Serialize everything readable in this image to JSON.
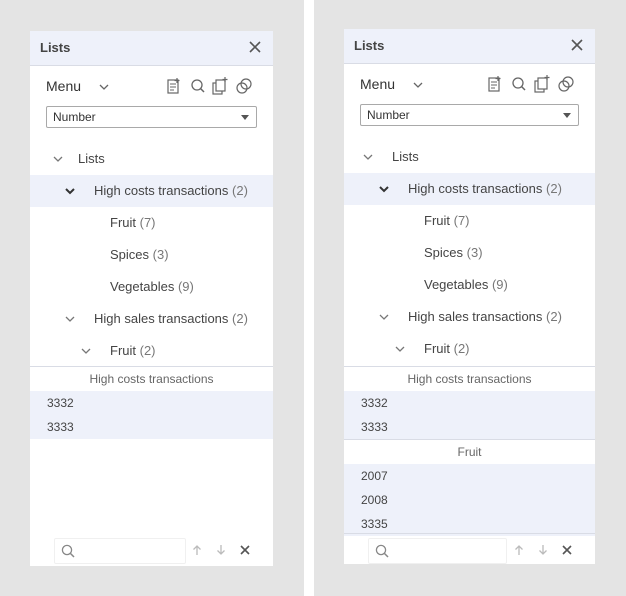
{
  "panels": [
    {
      "title": "Lists",
      "menu_label": "Menu",
      "select_value": "Number",
      "tree": [
        {
          "label": "Lists",
          "count": "",
          "level": 0,
          "chevron": "down",
          "selected": false
        },
        {
          "label": "High costs transactions",
          "count": "(2)",
          "level": 1,
          "chevron": "down-bold",
          "selected": true
        },
        {
          "label": "Fruit",
          "count": "(7)",
          "level": 2,
          "chevron": "",
          "selected": false
        },
        {
          "label": "Spices",
          "count": "(3)",
          "level": 2,
          "chevron": "",
          "selected": false
        },
        {
          "label": "Vegetables",
          "count": "(9)",
          "level": 2,
          "chevron": "",
          "selected": false
        },
        {
          "label": "High sales transactions",
          "count": "(2)",
          "level": 1,
          "chevron": "down",
          "selected": false
        },
        {
          "label": "Fruit",
          "count": "(2)",
          "level": 2,
          "chevron": "down",
          "selected": false
        }
      ],
      "sections": [
        {
          "header": "High costs transactions",
          "values": [
            "3332",
            "3333"
          ]
        }
      ]
    },
    {
      "title": "Lists",
      "menu_label": "Menu",
      "select_value": "Number",
      "tree": [
        {
          "label": "Lists",
          "count": "",
          "level": 0,
          "chevron": "down",
          "selected": false
        },
        {
          "label": "High costs transactions",
          "count": "(2)",
          "level": 1,
          "chevron": "down-bold",
          "selected": true
        },
        {
          "label": "Fruit",
          "count": "(7)",
          "level": 2,
          "chevron": "",
          "selected": false
        },
        {
          "label": "Spices",
          "count": "(3)",
          "level": 2,
          "chevron": "",
          "selected": false
        },
        {
          "label": "Vegetables",
          "count": "(9)",
          "level": 2,
          "chevron": "",
          "selected": false
        },
        {
          "label": "High sales transactions",
          "count": "(2)",
          "level": 1,
          "chevron": "down",
          "selected": false
        },
        {
          "label": "Fruit",
          "count": "(2)",
          "level": 2,
          "chevron": "down",
          "selected": false
        }
      ],
      "sections": [
        {
          "header": "High costs transactions",
          "values": [
            "3332",
            "3333"
          ]
        },
        {
          "header": "Fruit",
          "values": [
            "2007",
            "2008",
            "3335"
          ]
        }
      ]
    }
  ],
  "toolbar_icons": [
    "new-list-icon",
    "search-icon",
    "copy-list-icon",
    "compare-lists-icon"
  ],
  "search": {
    "placeholder": ""
  },
  "colors": {
    "header_bg": "#eef1fa",
    "selected_bg": "#eef1fa",
    "panel_bg": "#ffffff",
    "page_bg": "#e4e4e4"
  }
}
